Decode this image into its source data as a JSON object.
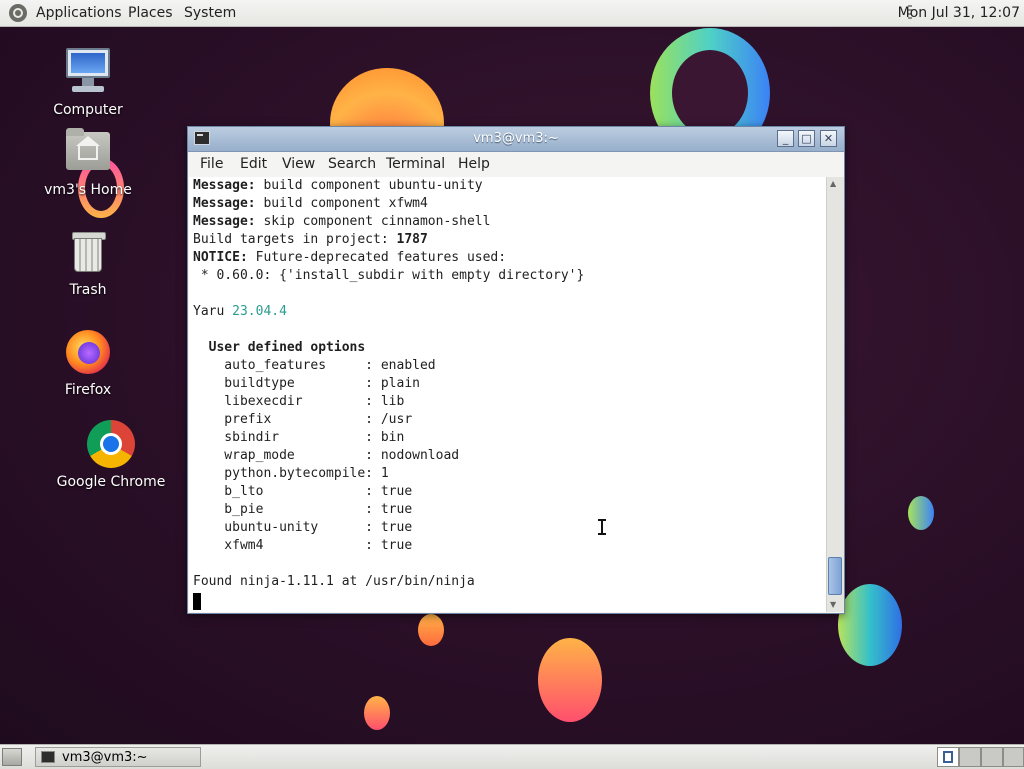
{
  "top_panel": {
    "menus": [
      "Applications",
      "Places",
      "System"
    ],
    "clock": "Mon Jul 31, 12:07"
  },
  "desktop_icons": [
    {
      "label": "Computer",
      "icon": "computer-icon"
    },
    {
      "label": "vm3's Home",
      "icon": "home-folder-icon"
    },
    {
      "label": "Trash",
      "icon": "trash-icon"
    },
    {
      "label": "Firefox",
      "icon": "firefox-icon"
    },
    {
      "label": "Google Chrome",
      "icon": "chrome-icon"
    }
  ],
  "window": {
    "title": "vm3@vm3:~",
    "menu": [
      "File",
      "Edit",
      "View",
      "Search",
      "Terminal",
      "Help"
    ],
    "lines": [
      {
        "bold": "Message:",
        "text": " build component ubuntu-unity"
      },
      {
        "bold": "Message:",
        "text": " build component xfwm4"
      },
      {
        "bold": "Message:",
        "text": " skip component cinnamon-shell"
      },
      {
        "text": "Build targets in project: ",
        "bold_after": "1787"
      },
      {
        "bold": "NOTICE:",
        "text": " Future-deprecated features used:"
      },
      {
        "text": " * 0.60.0: {'install_subdir with empty directory'}"
      },
      {
        "text": ""
      },
      {
        "text": "Yaru ",
        "teal": "23.04.4"
      },
      {
        "text": ""
      },
      {
        "bold": "  User defined options",
        "text": ""
      },
      {
        "text": "    auto_features     : enabled"
      },
      {
        "text": "    buildtype         : plain"
      },
      {
        "text": "    libexecdir        : lib"
      },
      {
        "text": "    prefix            : /usr"
      },
      {
        "text": "    sbindir           : bin"
      },
      {
        "text": "    wrap_mode         : nodownload"
      },
      {
        "text": "    python.bytecompile: 1"
      },
      {
        "text": "    b_lto             : true"
      },
      {
        "text": "    b_pie             : true"
      },
      {
        "text": "    ubuntu-unity      : true"
      },
      {
        "text": "    xfwm4             : true"
      },
      {
        "text": ""
      },
      {
        "text": "Found ninja-1.11.1 at /usr/bin/ninja"
      }
    ]
  },
  "taskbar": {
    "task_label": "vm3@vm3:~"
  },
  "colors": {
    "titlebar": "#97afcb",
    "version_teal": "#2a9d8f",
    "desktop_bg": "#2a0f27"
  }
}
